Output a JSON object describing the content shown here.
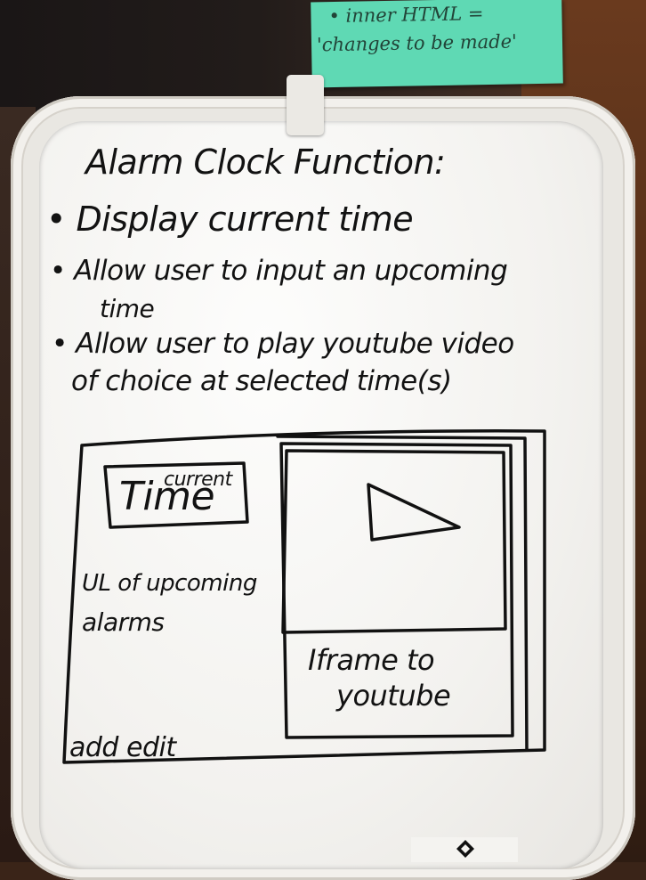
{
  "sticky_note": {
    "line1": "• inner HTML =",
    "line2": "'changes to be made'"
  },
  "whiteboard": {
    "title": "Alarm Clock Function:",
    "bullets": [
      "• Display current time",
      "• Allow user to input an upcoming",
      "time",
      "• Allow user to play youtube video",
      "of choice at selected time(s)"
    ],
    "wireframe": {
      "time_box_big": "Time",
      "time_box_small": "current",
      "list_line1": "UL of upcoming",
      "list_line2": "alarms",
      "iframe_line1": "Iframe to",
      "iframe_line2": "youtube",
      "footer": "add edit"
    }
  }
}
